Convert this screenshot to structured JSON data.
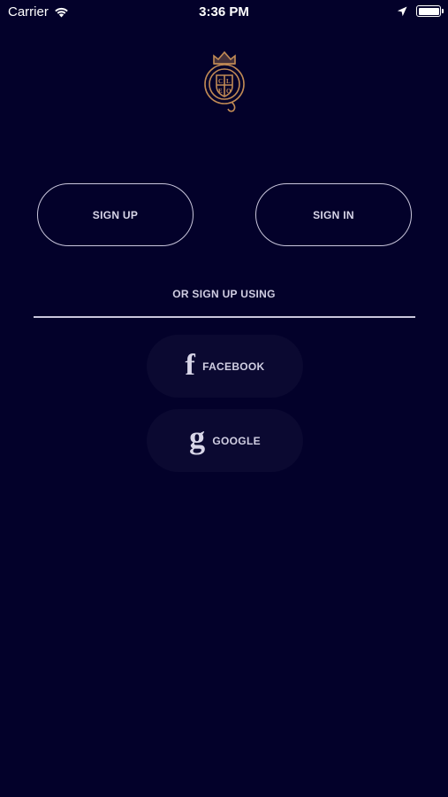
{
  "status_bar": {
    "carrier": "Carrier",
    "time": "3:36 PM"
  },
  "auth": {
    "sign_up_label": "SIGN UP",
    "sign_in_label": "SIGN IN",
    "or_label": "OR SIGN UP USING"
  },
  "social": {
    "facebook_glyph": "f",
    "facebook_label": "FACEBOOK",
    "google_glyph": "g",
    "google_label": "GOOGLE"
  },
  "colors": {
    "background": "#03012a",
    "logo_gold": "#c08a55",
    "border": "#c9c6dc"
  }
}
